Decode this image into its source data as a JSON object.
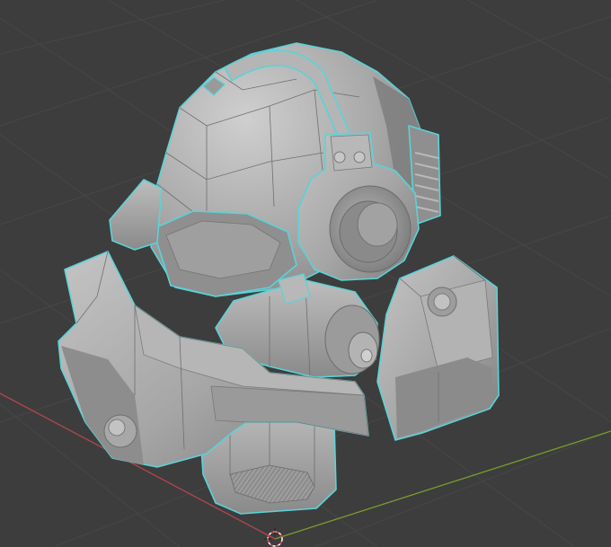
{
  "viewport": {
    "background_color": "#3d3d3d",
    "grid_color": "#464646",
    "x_axis_color": "#b0454f",
    "y_axis_color": "#7a9c2c",
    "selection_outline_color": "#5ad3d8",
    "mesh_color": "#a9a9a9",
    "selected_object": "helmet-mesh",
    "origin_icon": "3d-cursor-icon"
  }
}
